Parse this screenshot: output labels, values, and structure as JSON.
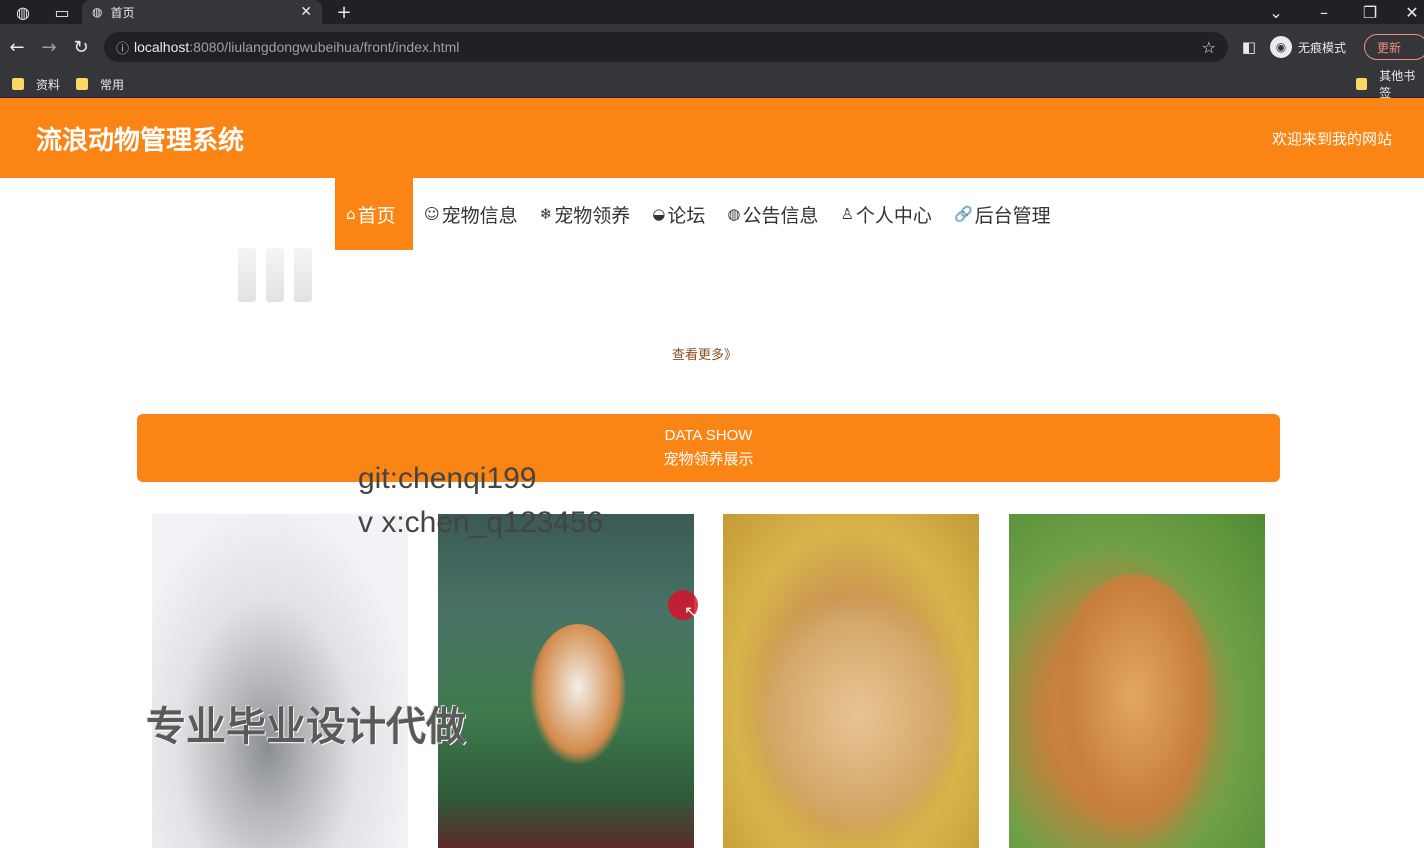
{
  "browser": {
    "tab_title": "首页",
    "url_host": "localhost",
    "url_path": ":8080/liulangdongwubeihua/front/index.html",
    "incognito_label": "无痕模式",
    "update_label": "更新",
    "bookmarks": [
      "资料",
      "常用"
    ],
    "other_bookmarks": "其他书签"
  },
  "header": {
    "title": "流浪动物管理系统",
    "welcome": "欢迎来到我的网站"
  },
  "nav": [
    {
      "icon": "⌂",
      "label": "首页"
    },
    {
      "icon": "☺",
      "label": "宠物信息"
    },
    {
      "icon": "❄",
      "label": "宠物领养"
    },
    {
      "icon": "◒",
      "label": "论坛"
    },
    {
      "icon": "◍",
      "label": "公告信息"
    },
    {
      "icon": "♙",
      "label": "个人中心"
    },
    {
      "icon": "🔗",
      "label": "后台管理"
    }
  ],
  "more_link": "查看更多》",
  "data_show": {
    "en": "DATA SHOW",
    "cn": "宠物领养展示"
  },
  "watermarks": {
    "git": "git:chenqi199",
    "vx": "v x:chen_q123456",
    "pro": "专业毕业设计代做"
  },
  "colors": {
    "accent": "#fb8514"
  }
}
